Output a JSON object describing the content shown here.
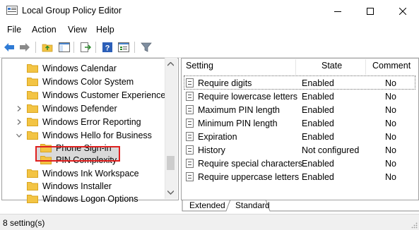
{
  "window": {
    "title": "Local Group Policy Editor",
    "controls": {
      "minimize": "minimize-icon",
      "maximize": "maximize-icon",
      "close": "close-icon"
    }
  },
  "menu": [
    "File",
    "Action",
    "View",
    "Help"
  ],
  "toolbar": [
    "back-icon",
    "forward-icon",
    "up-folder-icon",
    "show-hide-tree-icon",
    "export-list-icon",
    "help-icon",
    "properties-icon",
    "filter-icon"
  ],
  "tree": {
    "items": [
      {
        "label": "Windows Calendar",
        "arrow": ""
      },
      {
        "label": "Windows Color System",
        "arrow": ""
      },
      {
        "label": "Windows Customer Experience Ir",
        "arrow": ""
      },
      {
        "label": "Windows Defender",
        "arrow": ">"
      },
      {
        "label": "Windows Error Reporting",
        "arrow": ">"
      },
      {
        "label": "Windows Hello for Business",
        "arrow": "v"
      },
      {
        "label": "Phone Sign-in",
        "arrow": ""
      },
      {
        "label": "PIN Complexity",
        "arrow": ""
      },
      {
        "label": "Windows Ink Workspace",
        "arrow": ""
      },
      {
        "label": "Windows Installer",
        "arrow": ""
      },
      {
        "label": "Windows Logon Options",
        "arrow": ""
      }
    ],
    "selected": "PIN Complexity"
  },
  "list": {
    "columns": {
      "setting": "Setting",
      "state": "State",
      "comment": "Comment"
    },
    "rows": [
      {
        "setting": "Require digits",
        "state": "Enabled",
        "comment": "No"
      },
      {
        "setting": "Require lowercase letters",
        "state": "Enabled",
        "comment": "No"
      },
      {
        "setting": "Maximum PIN length",
        "state": "Enabled",
        "comment": "No"
      },
      {
        "setting": "Minimum PIN length",
        "state": "Enabled",
        "comment": "No"
      },
      {
        "setting": "Expiration",
        "state": "Enabled",
        "comment": "No"
      },
      {
        "setting": "History",
        "state": "Not configured",
        "comment": "No"
      },
      {
        "setting": "Require special characters",
        "state": "Enabled",
        "comment": "No"
      },
      {
        "setting": "Require uppercase letters",
        "state": "Enabled",
        "comment": "No"
      }
    ]
  },
  "tabs": {
    "extended": "Extended",
    "standard": "Standard",
    "active": "Standard"
  },
  "status": {
    "text": "8 setting(s)"
  },
  "colors": {
    "folder": "#f3c444",
    "folder_edge": "#d9a520",
    "highlight_border": "#e0201f",
    "selection": "#d9d9d9"
  }
}
